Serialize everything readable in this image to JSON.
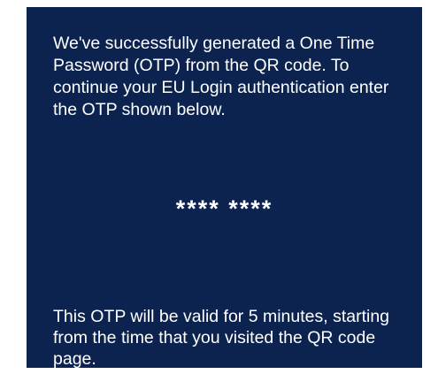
{
  "intro_text": "We've successfully generated a One Time Password (OTP) from the QR code. To continue your EU Login authentication enter the OTP shown below.",
  "otp_value": "**** ****",
  "validity_text": "This OTP will be valid for 5 minutes, starting from the time that you visited the QR code page.",
  "colors": {
    "background": "#0c2350",
    "text": "#ffffff"
  }
}
